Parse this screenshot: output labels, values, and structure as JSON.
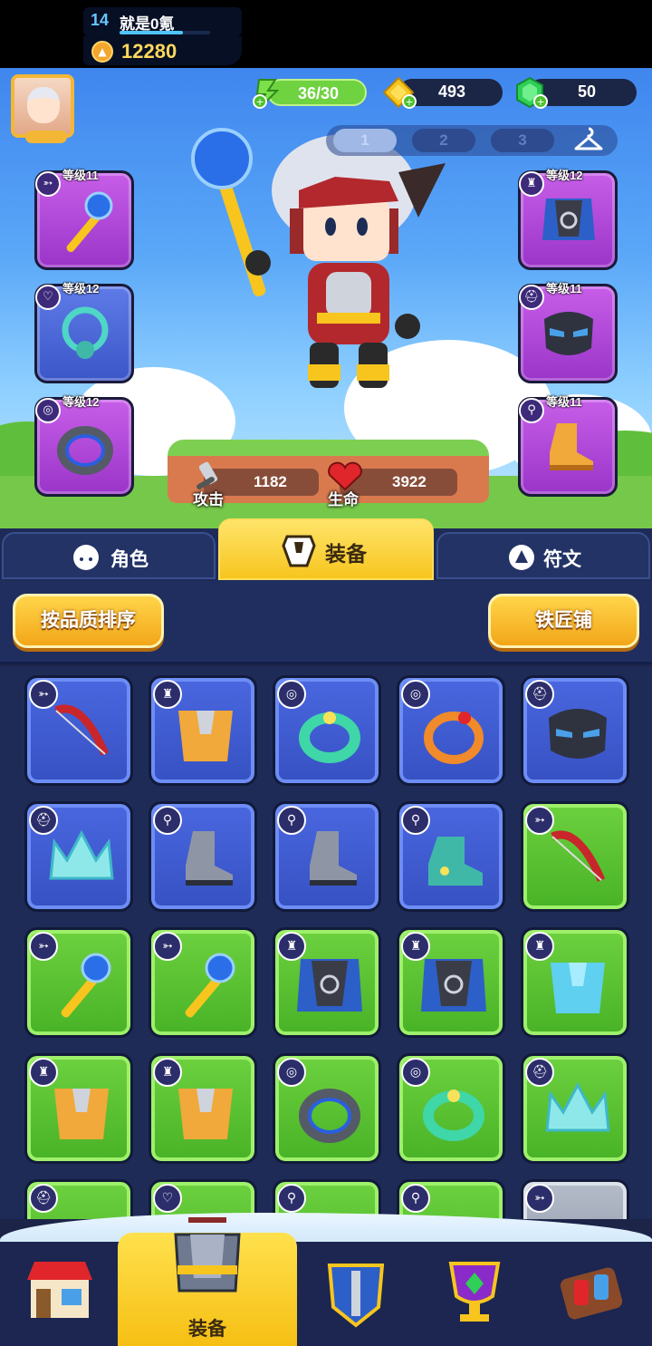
{
  "player": {
    "level": "14",
    "name": "就是0氪",
    "xp_fraction": 0.7,
    "power": "12280"
  },
  "resources": {
    "energy": "36/30",
    "coins": "493",
    "gems": "50"
  },
  "loadout_tabs": [
    "1",
    "2",
    "3"
  ],
  "active_loadout": 0,
  "equipped": {
    "weapon": {
      "level": "等级11",
      "item": "staff"
    },
    "necklace": {
      "level": "等级12",
      "item": "octopus-necklace"
    },
    "ring": {
      "level": "等级12",
      "item": "dark-ring"
    },
    "armor": {
      "level": "等级12",
      "item": "dark-cloak"
    },
    "helmet": {
      "level": "等级11",
      "item": "dark-mask"
    },
    "boots": {
      "level": "等级11",
      "item": "orange-boots"
    }
  },
  "stats": {
    "attack_label": "攻击",
    "attack_value": "1182",
    "hp_label": "生命",
    "hp_value": "3922"
  },
  "tabs": {
    "character": "角色",
    "equipment": "装备",
    "runes": "符文",
    "active": "equipment"
  },
  "actions": {
    "sort": "按品质排序",
    "blacksmith": "铁匠铺"
  },
  "inventory": [
    {
      "slot": "weapon",
      "rarity": "blue",
      "item": "red-bow"
    },
    {
      "slot": "armor",
      "rarity": "blue",
      "item": "orange-armor"
    },
    {
      "slot": "ring",
      "rarity": "blue",
      "item": "teal-ring"
    },
    {
      "slot": "ring",
      "rarity": "blue",
      "item": "orange-ring"
    },
    {
      "slot": "helmet",
      "rarity": "blue",
      "item": "dark-mask"
    },
    {
      "slot": "helmet",
      "rarity": "blue",
      "item": "ice-crown"
    },
    {
      "slot": "boots",
      "rarity": "blue",
      "item": "gray-boots"
    },
    {
      "slot": "boots",
      "rarity": "blue",
      "item": "gray-boots"
    },
    {
      "slot": "boots",
      "rarity": "blue",
      "item": "teal-boots"
    },
    {
      "slot": "weapon",
      "rarity": "green",
      "item": "red-bow"
    },
    {
      "slot": "weapon",
      "rarity": "green",
      "item": "staff"
    },
    {
      "slot": "weapon",
      "rarity": "green",
      "item": "staff"
    },
    {
      "slot": "armor",
      "rarity": "green",
      "item": "dark-cloak"
    },
    {
      "slot": "armor",
      "rarity": "green",
      "item": "dark-cloak"
    },
    {
      "slot": "armor",
      "rarity": "green",
      "item": "ice-armor"
    },
    {
      "slot": "armor",
      "rarity": "green",
      "item": "orange-armor"
    },
    {
      "slot": "armor",
      "rarity": "green",
      "item": "orange-armor"
    },
    {
      "slot": "ring",
      "rarity": "green",
      "item": "dark-ring"
    },
    {
      "slot": "ring",
      "rarity": "green",
      "item": "teal-ring"
    },
    {
      "slot": "helmet",
      "rarity": "green",
      "item": "ice-crown"
    },
    {
      "slot": "helmet",
      "rarity": "green",
      "item": "unknown"
    },
    {
      "slot": "necklace",
      "rarity": "green",
      "item": "unknown"
    },
    {
      "slot": "boots",
      "rarity": "green",
      "item": "unknown"
    },
    {
      "slot": "boots",
      "rarity": "green",
      "item": "unknown"
    },
    {
      "slot": "weapon",
      "rarity": "gray",
      "item": "unknown"
    }
  ],
  "bottom_nav": {
    "items": [
      "shop-icon",
      "equipment-icon",
      "hero-shield-icon",
      "trophy-icon",
      "bag-icon"
    ],
    "active_label": "装备"
  },
  "colors": {
    "blue_rarity": "#4a67e0",
    "green_rarity": "#6dd13f",
    "purple_rarity": "#b34be0",
    "gray_rarity": "#a7afbd",
    "accent_yellow": "#f7c51e"
  }
}
